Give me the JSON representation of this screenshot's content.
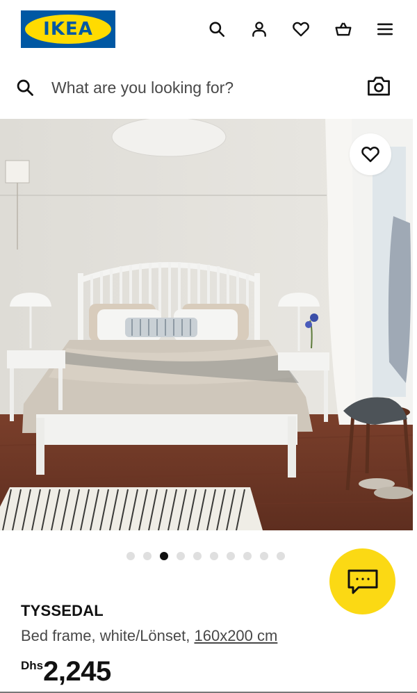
{
  "brand": {
    "logo_text": "IKEA",
    "blue": "#0058a3",
    "yellow": "#ffdb00"
  },
  "header": {
    "icons": [
      "search-icon",
      "user-icon",
      "heart-icon",
      "shopping-basket-icon",
      "hamburger-menu-icon"
    ]
  },
  "search": {
    "placeholder": "What are you looking for?",
    "value": "",
    "camera_icon": "camera-icon"
  },
  "gallery": {
    "image_count": 10,
    "active_index": 2,
    "favorite_icon": "heart-icon"
  },
  "chat": {
    "icon": "chat-bubble-icon",
    "color": "#fbd914"
  },
  "product": {
    "name": "TYSSEDAL",
    "description": "Bed frame, white/Lönset,",
    "size_link": "160x200 cm",
    "currency": "Dhs",
    "price": "2,245"
  }
}
